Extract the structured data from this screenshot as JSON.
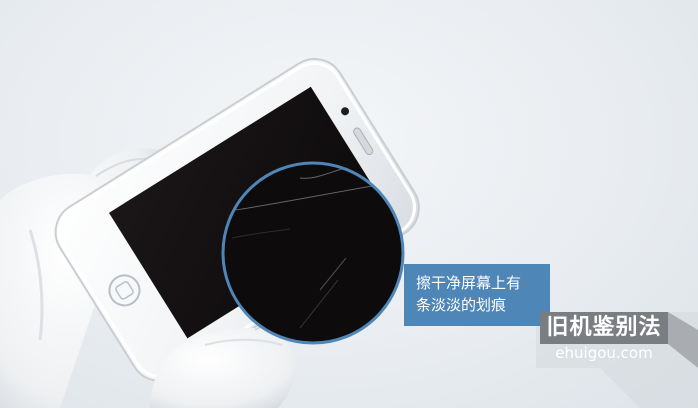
{
  "callout": {
    "line1": "擦干净屏幕上有",
    "line2": "条淡淡的划痕"
  },
  "brand": {
    "title": "旧机鉴别法",
    "url": "ehuigou.com"
  },
  "colors": {
    "callout_bg": "#4f86b8",
    "magnifier_ring": "#4f86b8",
    "brand_bg": "#7a7d81",
    "background": "#e9edf1"
  },
  "icons": {
    "home_button": "home-button-icon",
    "earpiece": "earpiece-icon",
    "front_camera": "front-camera-icon"
  }
}
